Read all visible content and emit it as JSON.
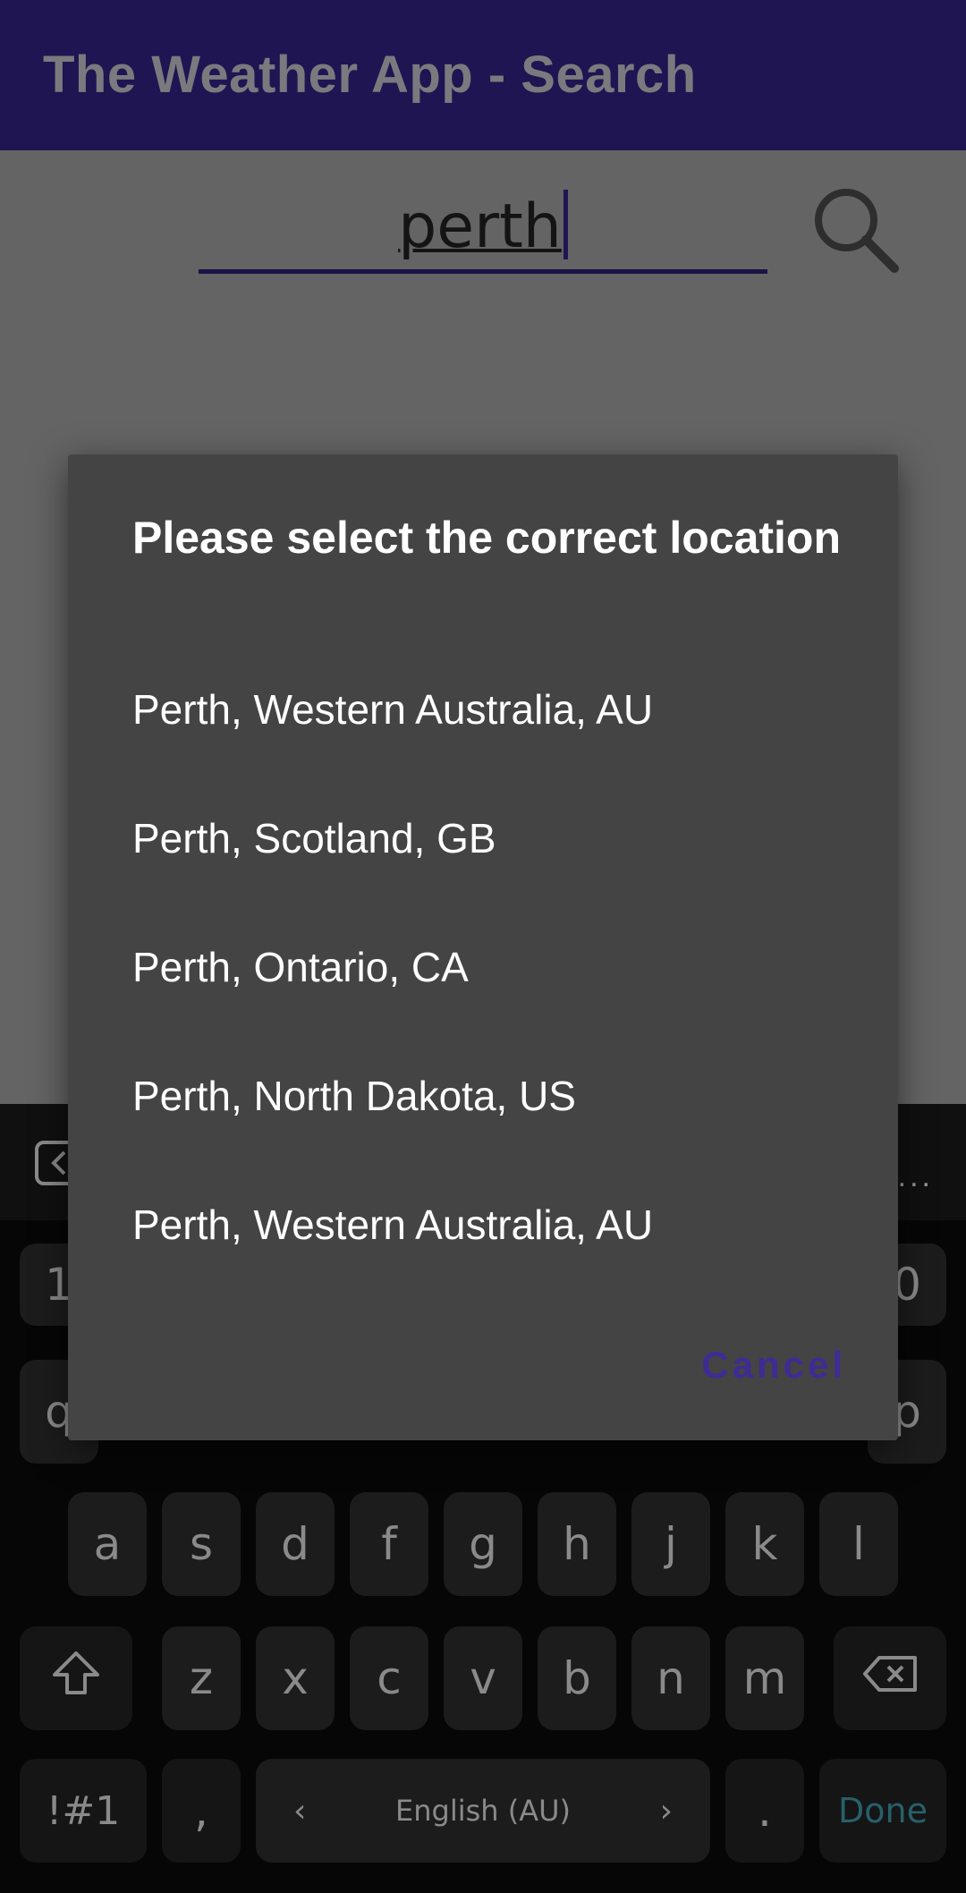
{
  "app": {
    "title": "The Weather App - Search"
  },
  "search": {
    "value": "perth"
  },
  "dialog": {
    "title": "Please select the correct location",
    "options": [
      "Perth, Western Australia, AU",
      "Perth, Scotland, GB",
      "Perth, Ontario, CA",
      "Perth, North Dakota, US",
      "Perth, Western Australia, AU"
    ],
    "cancel_label": "Cancel"
  },
  "keyboard": {
    "rows": {
      "row2": [
        "a",
        "s",
        "d",
        "f",
        "g",
        "h",
        "j",
        "k",
        "l"
      ],
      "row3": [
        "z",
        "x",
        "c",
        "v",
        "b",
        "n",
        "m"
      ]
    },
    "partial": {
      "num_left": "1",
      "num_right": "0",
      "q": "q",
      "p": "p"
    },
    "symbols_label": "!#1",
    "comma_label": ",",
    "language_label": "English (AU)",
    "period_label": ".",
    "done_label": "Done",
    "toolbar_more": "..."
  },
  "colors": {
    "appbar": "#1f1553",
    "dialog": "#444444",
    "accent": "#3f2b94",
    "done": "#27606a"
  }
}
